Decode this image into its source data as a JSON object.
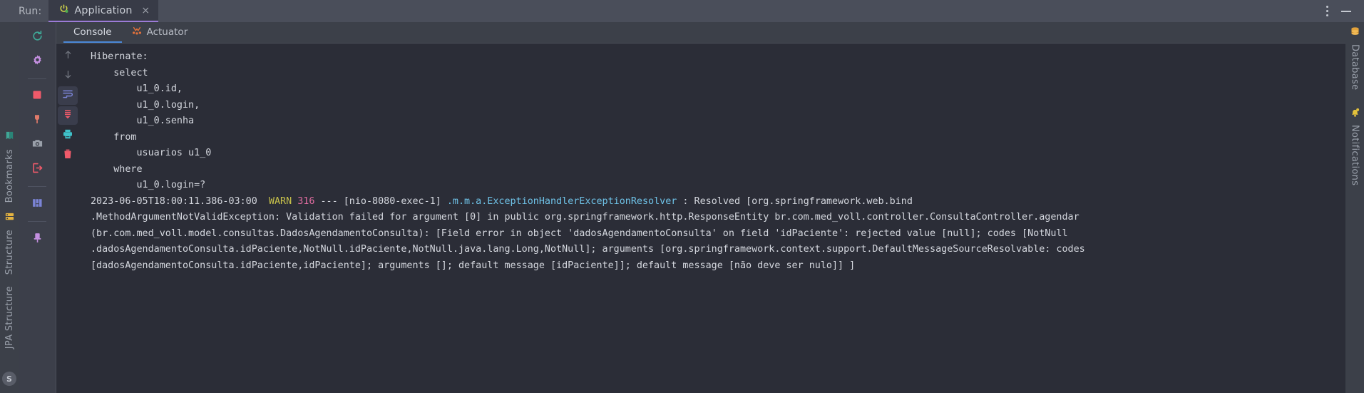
{
  "window": {
    "run_label": "Run:",
    "tab_title": "Application",
    "tab_close": "×",
    "more_options_icon": "more-vertical-icon",
    "minimize_icon": "minimize-icon"
  },
  "console_tabs": [
    {
      "label": "Console",
      "selected": true,
      "icon": ""
    },
    {
      "label": "Actuator",
      "selected": false,
      "icon": "actuator-icon"
    }
  ],
  "run_toolbar": [
    {
      "name": "rerun-icon",
      "title": "Rerun"
    },
    {
      "name": "settings-gear-icon",
      "title": "Modify Run Configuration"
    },
    {
      "name": "stop-icon",
      "title": "Stop"
    },
    {
      "name": "attach-debugger-icon",
      "title": "Attach Debugger"
    },
    {
      "name": "camera-snapshot-icon",
      "title": "Capture Memory Snapshot"
    },
    {
      "name": "exit-icon",
      "title": "Exit"
    },
    {
      "name": "layout-icon",
      "title": "Layout Settings"
    },
    {
      "name": "pin-icon",
      "title": "Pin Tab"
    }
  ],
  "console_toolbar": [
    {
      "name": "scroll-up-icon",
      "title": "Up the Stack Trace",
      "active": false
    },
    {
      "name": "scroll-down-icon",
      "title": "Down the Stack Trace",
      "active": false
    },
    {
      "name": "soft-wrap-icon",
      "title": "Soft-Wrap",
      "active": true
    },
    {
      "name": "scroll-to-end-icon",
      "title": "Scroll to End",
      "active": true
    },
    {
      "name": "print-icon",
      "title": "Print",
      "active": false
    },
    {
      "name": "clear-all-icon",
      "title": "Clear All",
      "active": false
    }
  ],
  "left_stripe": [
    {
      "label": "Bookmarks",
      "icon": "bookmarks-icon"
    },
    {
      "label": "Structure",
      "icon": "structure-icon"
    },
    {
      "label": "JPA Structure",
      "icon": "jpa-structure-icon"
    }
  ],
  "left_stripe_bottom": {
    "label": "S",
    "icon": "spring-icon"
  },
  "right_stripe": [
    {
      "label": "Database",
      "icon": "database-icon"
    },
    {
      "label": "Notifications",
      "icon": "notifications-bell-icon"
    }
  ],
  "console": {
    "lines": [
      {
        "segments": [
          {
            "text": "Hibernate: ",
            "style": "plain"
          }
        ]
      },
      {
        "segments": [
          {
            "text": "    select ",
            "style": "plain"
          }
        ]
      },
      {
        "segments": [
          {
            "text": "        u1_0.id,",
            "style": "plain"
          }
        ]
      },
      {
        "segments": [
          {
            "text": "        u1_0.login,",
            "style": "plain"
          }
        ]
      },
      {
        "segments": [
          {
            "text": "        u1_0.senha ",
            "style": "plain"
          }
        ]
      },
      {
        "segments": [
          {
            "text": "    from ",
            "style": "plain"
          }
        ]
      },
      {
        "segments": [
          {
            "text": "        usuarios u1_0 ",
            "style": "plain"
          }
        ]
      },
      {
        "segments": [
          {
            "text": "    where ",
            "style": "plain"
          }
        ]
      },
      {
        "segments": [
          {
            "text": "        u1_0.login=?",
            "style": "plain"
          }
        ]
      },
      {
        "segments": [
          {
            "text": "2023-06-05T18:00:11.386-03:00 ",
            "style": "plain"
          },
          {
            "text": " WARN",
            "style": "warn"
          },
          {
            "text": " ",
            "style": "plain"
          },
          {
            "text": "316",
            "style": "num"
          },
          {
            "text": " --- [nio-8080-exec-1] ",
            "style": "plain"
          },
          {
            "text": ".m.m.a.ExceptionHandlerExceptionResolver",
            "style": "logger"
          },
          {
            "text": " : Resolved [org.springframework.web.bind",
            "style": "plain"
          }
        ]
      },
      {
        "segments": [
          {
            "text": ".MethodArgumentNotValidException: Validation failed for argument [0] in public org.springframework.http.ResponseEntity br.com.med_voll.controller.ConsultaController.agendar",
            "style": "plain"
          }
        ]
      },
      {
        "segments": [
          {
            "text": "(br.com.med_voll.model.consultas.DadosAgendamentoConsulta): [Field error in object 'dadosAgendamentoConsulta' on field 'idPaciente': rejected value [null]; codes [NotNull",
            "style": "plain"
          }
        ]
      },
      {
        "segments": [
          {
            "text": ".dadosAgendamentoConsulta.idPaciente,NotNull.idPaciente,NotNull.java.lang.Long,NotNull]; arguments [org.springframework.context.support.DefaultMessageSourceResolvable: codes",
            "style": "plain"
          }
        ]
      },
      {
        "segments": [
          {
            "text": "[dadosAgendamentoConsulta.idPaciente,idPaciente]; arguments []; default message [idPaciente]]; default message [não deve ser nulo]] ]",
            "style": "plain"
          }
        ]
      }
    ]
  },
  "colors": {
    "console_bg": "#2b2d37",
    "panel_bg": "#3c4049",
    "header_bg": "#4a4e5a",
    "tab_active_bg": "#383b47",
    "accent_purple": "#9b7bd6",
    "accent_blue": "#4a88d8",
    "warn": "#c7c14b",
    "number": "#e06ca0",
    "logger": "#6fc3e8",
    "text": "#d4d7de"
  }
}
